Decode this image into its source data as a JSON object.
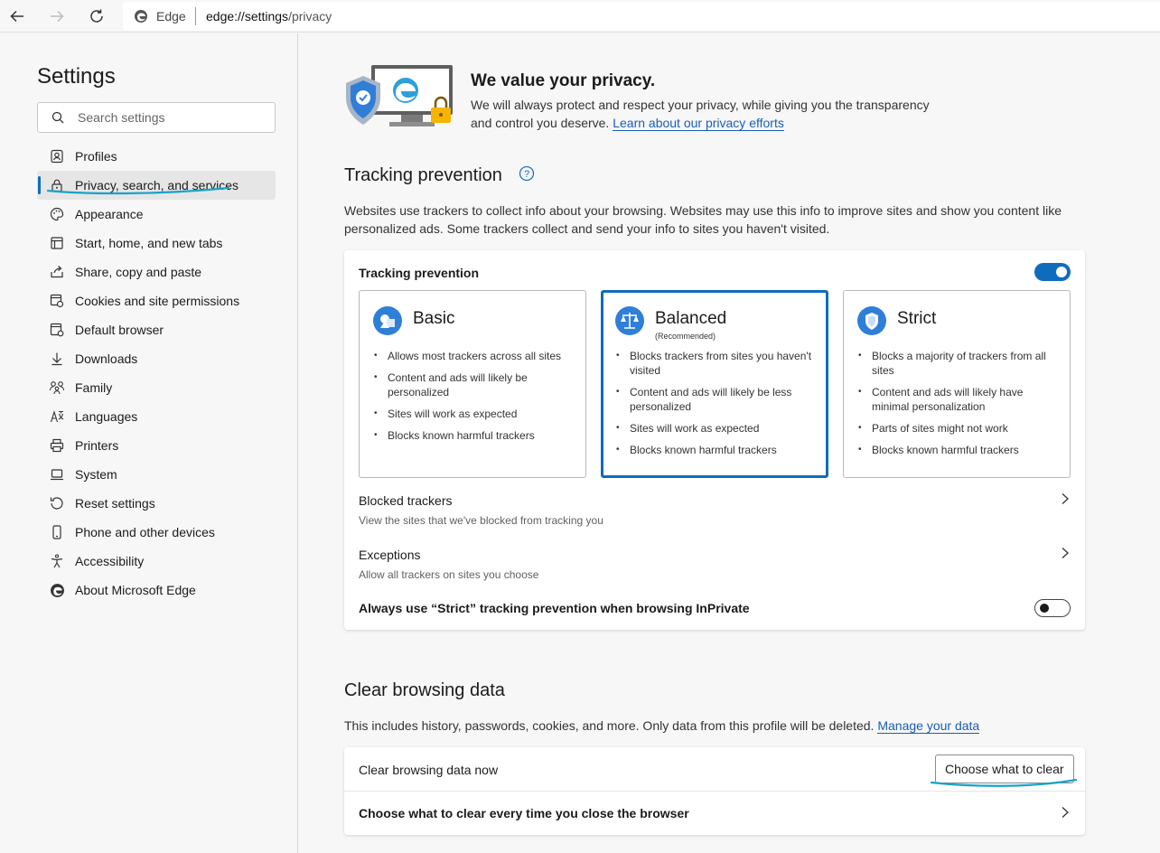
{
  "browser": {
    "site_name": "Edge",
    "url_host": "edge://settings",
    "url_path": "/privacy"
  },
  "sidebar": {
    "title": "Settings",
    "search_placeholder": "Search settings",
    "items": [
      {
        "label": "Profiles",
        "icon": "profile-icon"
      },
      {
        "label": "Privacy, search, and services",
        "icon": "lock-icon",
        "active": true
      },
      {
        "label": "Appearance",
        "icon": "palette-icon"
      },
      {
        "label": "Start, home, and new tabs",
        "icon": "power-icon"
      },
      {
        "label": "Share, copy and paste",
        "icon": "share-icon"
      },
      {
        "label": "Cookies and site permissions",
        "icon": "cookies-icon"
      },
      {
        "label": "Default browser",
        "icon": "browser-icon"
      },
      {
        "label": "Downloads",
        "icon": "download-icon"
      },
      {
        "label": "Family",
        "icon": "family-icon"
      },
      {
        "label": "Languages",
        "icon": "languages-icon"
      },
      {
        "label": "Printers",
        "icon": "printer-icon"
      },
      {
        "label": "System",
        "icon": "laptop-icon"
      },
      {
        "label": "Reset settings",
        "icon": "reset-icon"
      },
      {
        "label": "Phone and other devices",
        "icon": "phone-icon"
      },
      {
        "label": "Accessibility",
        "icon": "accessibility-icon"
      },
      {
        "label": "About Microsoft Edge",
        "icon": "edge-icon"
      }
    ]
  },
  "hero": {
    "title": "We value your privacy.",
    "text_line1": "We will always protect and respect your privacy, while giving you the transparency",
    "text_line2": "and control you deserve.",
    "link": "Learn about our privacy efforts"
  },
  "tracking": {
    "heading": "Tracking prevention",
    "description": "Websites use trackers to collect info about your browsing. Websites may use this info to improve sites and show you content like personalized ads. Some trackers collect and send your info to sites you haven't visited.",
    "card_title": "Tracking prevention",
    "enabled": true,
    "options": [
      {
        "title": "Basic",
        "subtitle": "",
        "icon": "basic-shapes-icon",
        "bullets": [
          "Allows most trackers across all sites",
          "Content and ads will likely be personalized",
          "Sites will work as expected",
          "Blocks known harmful trackers"
        ]
      },
      {
        "title": "Balanced",
        "subtitle": "(Recommended)",
        "icon": "balance-scale-icon",
        "selected": true,
        "bullets": [
          "Blocks trackers from sites you haven't visited",
          "Content and ads will likely be less personalized",
          "Sites will work as expected",
          "Blocks known harmful trackers"
        ]
      },
      {
        "title": "Strict",
        "subtitle": "",
        "icon": "shield-icon",
        "bullets": [
          "Blocks a majority of trackers from all sites",
          "Content and ads will likely have minimal personalization",
          "Parts of sites might not work",
          "Blocks known harmful trackers"
        ]
      }
    ],
    "blocked_title": "Blocked trackers",
    "blocked_sub": "View the sites that we've blocked from tracking you",
    "exceptions_title": "Exceptions",
    "exceptions_sub": "Allow all trackers on sites you choose",
    "inprivate_label": "Always use “Strict” tracking prevention when browsing InPrivate",
    "inprivate_enabled": false
  },
  "clear": {
    "heading": "Clear browsing data",
    "description": "This includes history, passwords, cookies, and more. Only data from this profile will be deleted.",
    "link": "Manage your data",
    "row1_label": "Clear browsing data now",
    "button": "Choose what to clear",
    "row2_label": "Choose what to clear every time you close the browser"
  },
  "colors": {
    "accent": "#0f6cbd",
    "annotation": "#1aa3c7"
  }
}
